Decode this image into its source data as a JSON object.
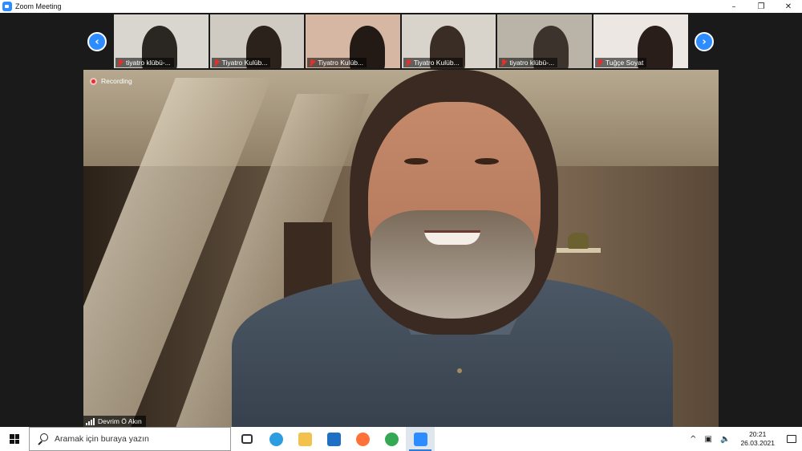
{
  "window": {
    "title": "Zoom Meeting",
    "controls": [
      "–",
      "❐",
      "✕"
    ]
  },
  "gallery": {
    "prev_label": "‹",
    "next_label": "›",
    "participants": [
      {
        "name": "tiyatro klübü-...",
        "muted": true,
        "bg": "#d9d6cf",
        "person": "#2a2622"
      },
      {
        "name": "Tiyatro Kulüb...",
        "muted": true,
        "bg": "#cfcac2",
        "person": "#2b221c"
      },
      {
        "name": "Tiyatro Kulüb...",
        "muted": true,
        "bg": "#d5b7a3",
        "person": "#231a16"
      },
      {
        "name": "Tiyatro Kulüb...",
        "muted": true,
        "bg": "#d8d4cc",
        "person": "#3a2d25"
      },
      {
        "name": "tiyatro klübü-...",
        "muted": true,
        "bg": "#b9b3a8",
        "person": "#3c332d"
      },
      {
        "name": "Tuğçe Soyat",
        "muted": true,
        "bg": "#ece7e3",
        "person": "#2a1e1a"
      }
    ]
  },
  "main": {
    "recording_label": "Recording",
    "speaker_name": "Devrim Ö Akın"
  },
  "taskbar": {
    "search_placeholder": "Aramak için buraya yazın",
    "apps": [
      {
        "icon": "task-view-icon",
        "color": "#333333",
        "active": false
      },
      {
        "icon": "edge-icon",
        "color": "#2b9de0",
        "active": false
      },
      {
        "icon": "file-explorer-icon",
        "color": "#f2c14e",
        "active": false
      },
      {
        "icon": "mail-icon",
        "color": "#1f6fc4",
        "active": false
      },
      {
        "icon": "firefox-icon",
        "color": "#ff7139",
        "active": false
      },
      {
        "icon": "chrome-icon",
        "color": "#34a853",
        "active": false
      },
      {
        "icon": "zoom-icon",
        "color": "#2d8cff",
        "active": true
      }
    ],
    "tray": {
      "chevron": "^",
      "time": "20:21",
      "date": "26.03.2021"
    }
  }
}
